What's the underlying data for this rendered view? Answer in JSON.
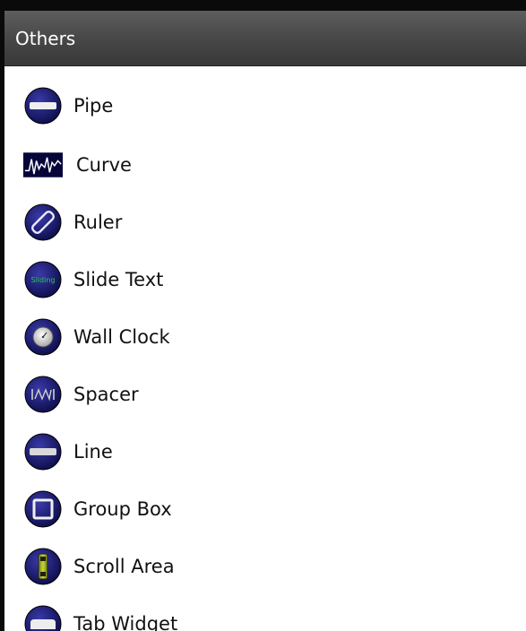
{
  "panel": {
    "title": "Others"
  },
  "items": [
    {
      "label": "Pipe",
      "icon": "pipe-icon"
    },
    {
      "label": "Curve",
      "icon": "curve-icon"
    },
    {
      "label": "Ruler",
      "icon": "ruler-icon"
    },
    {
      "label": "Slide Text",
      "icon": "slide-text-icon",
      "icon_text": "Sliding"
    },
    {
      "label": "Wall Clock",
      "icon": "wall-clock-icon"
    },
    {
      "label": "Spacer",
      "icon": "spacer-icon"
    },
    {
      "label": "Line",
      "icon": "line-icon"
    },
    {
      "label": "Group Box",
      "icon": "group-box-icon"
    },
    {
      "label": "Scroll Area",
      "icon": "scroll-area-icon"
    },
    {
      "label": "Tab Widget",
      "icon": "tab-widget-icon"
    }
  ],
  "colors": {
    "header_bg": "#4a4a4a",
    "icon_navy": "#1a1a6e",
    "curve_bg": "#05053a",
    "slide_text_green": "#22cc44"
  }
}
